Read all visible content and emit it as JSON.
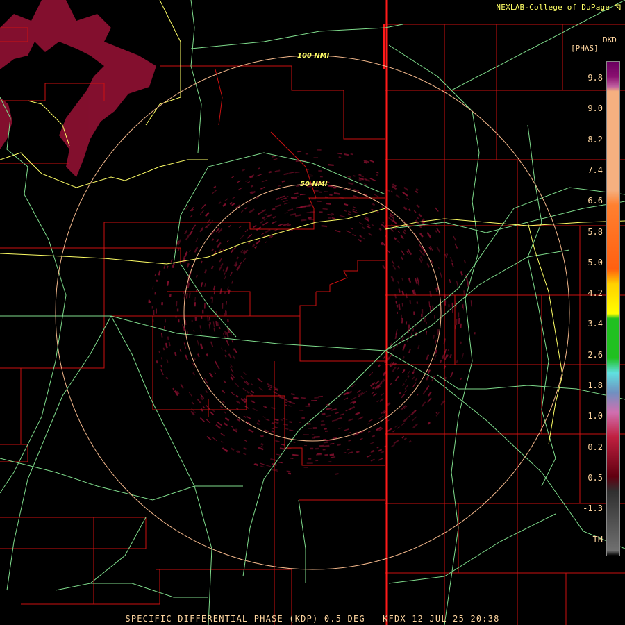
{
  "header": {
    "credit": "NEXLAB-College of DuPage",
    "credit_icon": "corner-arrow-icon"
  },
  "legend": {
    "unit": "DKD",
    "product_code": "[PHAS]",
    "tick_labels": [
      "9.8",
      "9.0",
      "8.2",
      "7.4",
      "6.6",
      "5.8",
      "5.0",
      "4.2",
      "3.4",
      "2.6",
      "1.8",
      "1.0",
      "0.2",
      "-0.5",
      "-1.3",
      "TH"
    ]
  },
  "rings": {
    "inner_label": "50 NMI",
    "outer_label": "100 NMI"
  },
  "footer": {
    "caption": "SPECIFIC DIFFERENTIAL PHASE (KDP) 0.5 DEG - KFDX 12 JUL 25 20:38"
  },
  "colors": {
    "background": "#000000",
    "county_lines": "#cc1111",
    "state_line": "#ff1a1a",
    "highways": "#7fdc8c",
    "interstate": "#ffff66",
    "range_rings": "#f5b98c",
    "text": "#ffd6a0",
    "echo": "#8a1030"
  }
}
